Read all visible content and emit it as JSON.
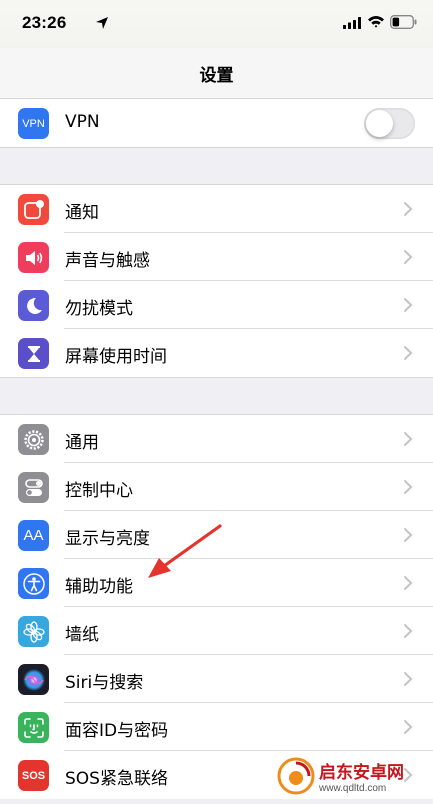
{
  "status_bar": {
    "time": "23:26"
  },
  "nav": {
    "title": "设置"
  },
  "colors": {
    "group_bg": "#efeff4",
    "accent_red": "#e4342d"
  },
  "groups": [
    {
      "items": [
        {
          "label": "VPN",
          "icon": "vpn-icon",
          "icon_text": "VPN",
          "icon_color": "#2f76f0",
          "control": "toggle",
          "toggle_on": false
        }
      ]
    },
    {
      "items": [
        {
          "label": "通知",
          "icon": "notification-icon",
          "icon_color": "#f04a3d"
        },
        {
          "label": "声音与触感",
          "icon": "speaker-icon",
          "icon_color": "#ef3e5b"
        },
        {
          "label": "勿扰模式",
          "icon": "moon-icon",
          "icon_color": "#5b5bd6"
        },
        {
          "label": "屏幕使用时间",
          "icon": "hourglass-icon",
          "icon_color": "#5a4fc9"
        }
      ]
    },
    {
      "items": [
        {
          "label": "通用",
          "icon": "gear-icon",
          "icon_color": "#8e8e93"
        },
        {
          "label": "控制中心",
          "icon": "toggles-icon",
          "icon_color": "#8e8e93"
        },
        {
          "label": "显示与亮度",
          "icon": "text-size-icon",
          "icon_text": "AA",
          "icon_color": "#2f76f0"
        },
        {
          "label": "辅助功能",
          "icon": "accessibility-icon",
          "icon_color": "#2f76f0"
        },
        {
          "label": "墙纸",
          "icon": "flower-icon",
          "icon_color": "#37a7e0"
        },
        {
          "label": "Siri与搜索",
          "icon": "siri-icon",
          "icon_color": "#1d1d2a"
        },
        {
          "label": "面容ID与密码",
          "icon": "faceid-icon",
          "icon_color": "#3ab45c"
        },
        {
          "label": "SOS紧急联络",
          "icon": "sos-icon",
          "icon_text": "SOS",
          "icon_color": "#e4342d"
        }
      ]
    }
  ],
  "watermark": {
    "title": "启东安卓网",
    "url": "www.qdltd.com"
  }
}
